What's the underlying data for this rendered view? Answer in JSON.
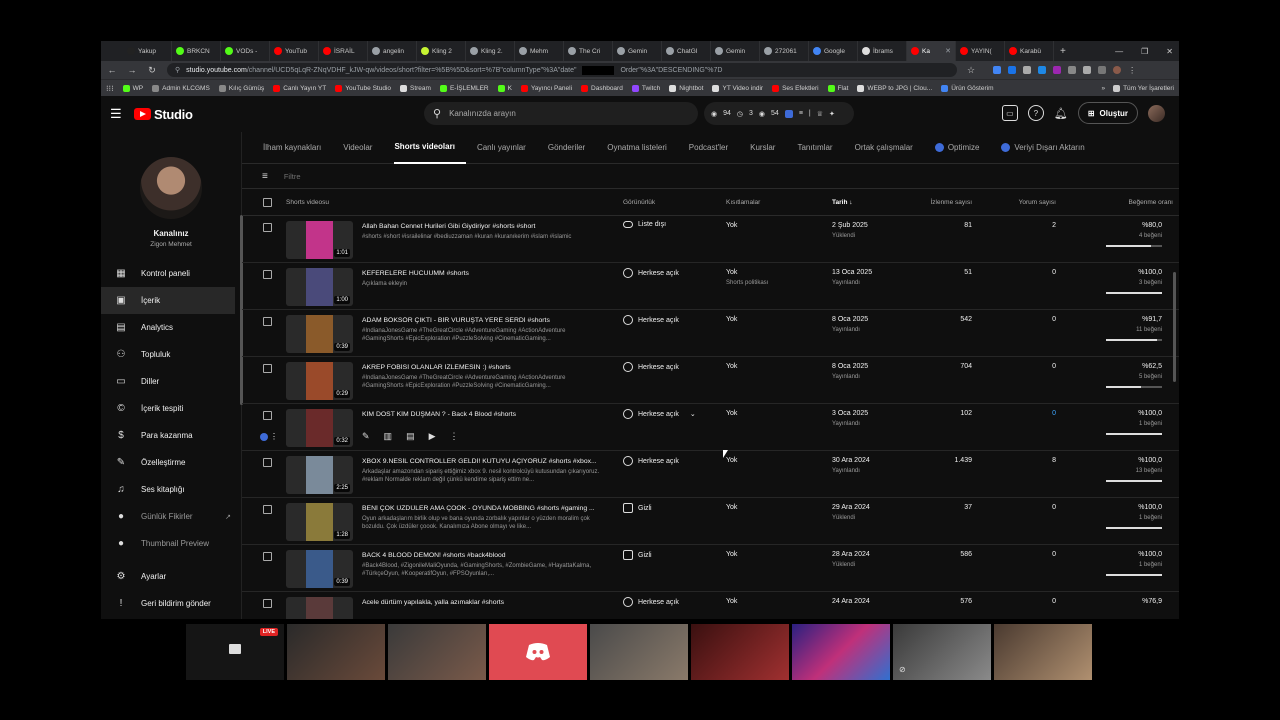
{
  "browser": {
    "tabs": [
      {
        "label": "Yakup",
        "color": "#222"
      },
      {
        "label": "BRKCN",
        "color": "#53fc18"
      },
      {
        "label": "VODs -",
        "color": "#53fc18"
      },
      {
        "label": "YouTub",
        "color": "#ff0000"
      },
      {
        "label": "İSRAİL",
        "color": "#ff0000"
      },
      {
        "label": "angelin",
        "color": "#9aa0a6"
      },
      {
        "label": "Kling 2",
        "color": "#c6f432"
      },
      {
        "label": "Kling 2.",
        "color": "#9aa0a6"
      },
      {
        "label": "Mehm",
        "color": "#9aa0a6"
      },
      {
        "label": "The Cri",
        "color": "#9aa0a6"
      },
      {
        "label": "Gemin",
        "color": "#9aa0a6"
      },
      {
        "label": "ChatGI",
        "color": "#9aa0a6"
      },
      {
        "label": "Gemin",
        "color": "#9aa0a6"
      },
      {
        "label": "272061",
        "color": "#9aa0a6"
      },
      {
        "label": "Google",
        "color": "#4285f4"
      },
      {
        "label": "İbrams",
        "color": "#ddd"
      },
      {
        "label": "Ka",
        "color": "#ff0000"
      },
      {
        "label": "YAYIN(",
        "color": "#ff0000"
      },
      {
        "label": "Karabü",
        "color": "#ff0000"
      }
    ],
    "active_tab": 16,
    "url_host": "studio.youtube.com",
    "url_path": "/channel/UCD5qLqR-ZNqVDHF_kJW-qw/videos/short?filter=%5B%5D&sort=%7B\"columnType\"%3A\"date\"",
    "url_tail": "Order\"%3A\"DESCENDING\"%7D",
    "bookmarks": [
      {
        "label": "WP",
        "color": "#53fc18"
      },
      {
        "label": "Admin KLCGMS",
        "color": "#888"
      },
      {
        "label": "Kılıç Gümüş",
        "color": "#888"
      },
      {
        "label": "Canlı Yayın YT",
        "color": "#ff0000"
      },
      {
        "label": "YouTube Studio",
        "color": "#ff0000"
      },
      {
        "label": "Stream",
        "color": "#ddd"
      },
      {
        "label": "E-İŞLEMLER",
        "color": "#53fc18"
      },
      {
        "label": "K",
        "color": "#53fc18"
      },
      {
        "label": "Yayıncı Paneli",
        "color": "#ff0000"
      },
      {
        "label": "Dashboard",
        "color": "#ff0000"
      },
      {
        "label": "Twitch",
        "color": "#9147ff"
      },
      {
        "label": "Nightbot",
        "color": "#ddd"
      },
      {
        "label": "YT Video indir",
        "color": "#ddd"
      },
      {
        "label": "Ses Efektleri",
        "color": "#ff0000"
      },
      {
        "label": "Flat",
        "color": "#53fc18"
      },
      {
        "label": "WEBP to JPG | Clou...",
        "color": "#ddd"
      },
      {
        "label": "Ürün Gösterim",
        "color": "#4285f4"
      }
    ],
    "bookmarks_more": "»",
    "all_bookmarks": "Tüm Yer İşaretleri"
  },
  "header": {
    "logo_text": "Studio",
    "search_placeholder": "Kanalınızda arayın",
    "stats": [
      "94",
      "3",
      "54"
    ],
    "create_label": "Oluştur"
  },
  "sidebar": {
    "channel_title": "Kanalınız",
    "channel_name": "Zigon Mehmet",
    "items": [
      {
        "label": "Kontrol paneli",
        "icon": "dashboard-icon",
        "glyph": "▦"
      },
      {
        "label": "İçerik",
        "icon": "content-icon",
        "glyph": "▣"
      },
      {
        "label": "Analytics",
        "icon": "analytics-icon",
        "glyph": "▤"
      },
      {
        "label": "Topluluk",
        "icon": "community-icon",
        "glyph": "⚇"
      },
      {
        "label": "Diller",
        "icon": "subtitles-icon",
        "glyph": "▭"
      },
      {
        "label": "İçerik tespiti",
        "icon": "copyright-icon",
        "glyph": "©"
      },
      {
        "label": "Para kazanma",
        "icon": "monetization-icon",
        "glyph": "$"
      },
      {
        "label": "Özelleştirme",
        "icon": "customization-icon",
        "glyph": "✎"
      },
      {
        "label": "Ses kitaplığı",
        "icon": "audio-library-icon",
        "glyph": "♫"
      },
      {
        "label": "Günlük Fikirler",
        "icon": "daily-ideas-icon",
        "glyph": "●"
      },
      {
        "label": "Thumbnail Preview",
        "icon": "thumbnail-preview-icon",
        "glyph": "●"
      },
      {
        "label": "Ayarlar",
        "icon": "settings-icon",
        "glyph": "⚙"
      },
      {
        "label": "Geri bildirim gönder",
        "icon": "feedback-icon",
        "glyph": "!"
      }
    ]
  },
  "content": {
    "tabs": [
      "İlham kaynakları",
      "Videolar",
      "Shorts videoları",
      "Canlı yayınlar",
      "Gönderiler",
      "Oynatma listeleri",
      "Podcast'ler",
      "Kurslar",
      "Tanıtımlar",
      "Ortak çalışmalar",
      "Optimize",
      "Veriyi Dışarı Aktarın"
    ],
    "active_tab": 2,
    "filter_placeholder": "Filtre",
    "columns": {
      "video": "Shorts videosu",
      "visibility": "Görünürlük",
      "restrictions": "Kısıtlamalar",
      "date": "Tarih",
      "views": "İzlenme sayısı",
      "comments": "Yorum sayısı",
      "likes": "Beğenme oranı"
    },
    "rows": [
      {
        "title": "Allah Bahan Cennet Hurileri Gibi Giydiriyor #shorts #short",
        "desc": "#shorts #short #israilelinar #bediuzzaman #kuran #kuranıkerim #islam #islamic",
        "duration": "1:01",
        "visibility": "Liste dışı",
        "vis_icon": "link-icon",
        "restriction": "Yok",
        "restriction_sub": "",
        "date": "2 Şub 2025",
        "status": "Yüklendi",
        "views": "81",
        "comments": "2",
        "likes_pct": "%80,0",
        "likes_sub": "4 beğeni",
        "like_ratio": 0.8,
        "thumb": "#c2348a"
      },
      {
        "title": "KEFERELERE HÜCUUMM #shorts",
        "desc": "Açıklama ekleyin",
        "duration": "1:00",
        "visibility": "Herkese açık",
        "vis_icon": "globe-icon",
        "restriction": "Yok",
        "restriction_sub": "Shorts politikası",
        "date": "13 Oca 2025",
        "status": "Yayınlandı",
        "views": "51",
        "comments": "0",
        "likes_pct": "%100,0",
        "likes_sub": "3 beğeni",
        "like_ratio": 1.0,
        "thumb": "#4a4a7a"
      },
      {
        "title": "ADAM BÖKSÖR ÇIKTI - BİR VURUŞTA YERE SERDİ #shorts",
        "desc": "#IndianaJonesGame #TheGreatCircle #AdventureGaming #ActionAdventure #GamingShorts #EpicExploration #PuzzleSolving #CinematicGaming...",
        "duration": "0:39",
        "visibility": "Herkese açık",
        "vis_icon": "globe-icon",
        "restriction": "Yok",
        "restriction_sub": "",
        "date": "8 Oca 2025",
        "status": "Yayınlandı",
        "views": "542",
        "comments": "0",
        "likes_pct": "%91,7",
        "likes_sub": "11 beğeni",
        "like_ratio": 0.917,
        "thumb": "#8a5a2a"
      },
      {
        "title": "AKREP FOBİSİ OLANLAR İZLEMESİN :) #shorts",
        "desc": "#IndianaJonesGame #TheGreatCircle #AdventureGaming #ActionAdventure #GamingShorts #EpicExploration #PuzzleSolving #CinematicGaming...",
        "duration": "0:29",
        "visibility": "Herkese açık",
        "vis_icon": "globe-icon",
        "restriction": "Yok",
        "restriction_sub": "",
        "date": "8 Oca 2025",
        "status": "Yayınlandı",
        "views": "704",
        "comments": "0",
        "likes_pct": "%62,5",
        "likes_sub": "5 beğeni",
        "like_ratio": 0.625,
        "thumb": "#9a4a2a"
      },
      {
        "title": "KİM DOST KİM DÜŞMAN ? - Back 4 Blood #shorts",
        "desc": "",
        "duration": "0:32",
        "visibility": "Herkese açık",
        "vis_icon": "globe-icon",
        "restriction": "Yok",
        "restriction_sub": "",
        "date": "3 Oca 2025",
        "status": "Yayınlandı",
        "views": "102",
        "comments": "0",
        "likes_pct": "%100,0",
        "likes_sub": "1 beğeni",
        "like_ratio": 1.0,
        "thumb": "#6a2a2a",
        "hover": true
      },
      {
        "title": "XBOX 9.NESİL CONTROLLER GELDİ! KUTUYU AÇIYORUZ #shorts #xbox...",
        "desc": "Arkadaşlar amazondan sipariş ettiğimiz xbox 9. nesil kontrolcüyü kutusundan çıkarıyoruz. #reklam Normalde reklam değil çünkü kendime sipariş ettim ne...",
        "duration": "2:25",
        "visibility": "Herkese açık",
        "vis_icon": "globe-icon",
        "restriction": "Yok",
        "restriction_sub": "",
        "date": "30 Ara 2024",
        "status": "Yayınlandı",
        "views": "1.439",
        "comments": "8",
        "likes_pct": "%100,0",
        "likes_sub": "13 beğeni",
        "like_ratio": 1.0,
        "thumb": "#7a8a9a"
      },
      {
        "title": "BENİ ÇOK ÜZDÜLER AMA ÇOOK - OYUNDA MOBBİNG #shorts #gaming ...",
        "desc": "Oyun arkadaşlarım birlik olup ve bana oyunda zorbalık yapınlar o yüzden moralim çok bozuldu. Çok üzdüler çoook. Kanalımıza Abone olmayı ve like...",
        "duration": "1:28",
        "visibility": "Gizli",
        "vis_icon": "lock-icon",
        "restriction": "Yok",
        "restriction_sub": "",
        "date": "29 Ara 2024",
        "status": "Yüklendi",
        "views": "37",
        "comments": "0",
        "likes_pct": "%100,0",
        "likes_sub": "1 beğeni",
        "like_ratio": 1.0,
        "thumb": "#8a7a3a"
      },
      {
        "title": "BACK 4 BLOOD DEMON! #shorts #back4blood",
        "desc": "#Back4Blood, #ZigonileMaliOyunda, #GamingShorts, #ZombieGame, #HayattaKalma, #TürkçeOyun, #KooperatifOyun, #FPSOyunları,...",
        "duration": "0:39",
        "visibility": "Gizli",
        "vis_icon": "lock-icon",
        "restriction": "Yok",
        "restriction_sub": "",
        "date": "28 Ara 2024",
        "status": "Yüklendi",
        "views": "586",
        "comments": "0",
        "likes_pct": "%100,0",
        "likes_sub": "1 beğeni",
        "like_ratio": 1.0,
        "thumb": "#3a5a8a"
      },
      {
        "title": "Acele dürtüm yapılakla, yalla azımaklar #shorts",
        "desc": "",
        "duration": "",
        "visibility": "Herkese açık",
        "vis_icon": "globe-icon",
        "restriction": "Yok",
        "restriction_sub": "",
        "date": "24 Ara 2024",
        "status": "",
        "views": "576",
        "comments": "0",
        "likes_pct": "%76,9",
        "likes_sub": "",
        "like_ratio": 0.769,
        "thumb": "#5a3a3a"
      }
    ]
  },
  "webcam_strip": {
    "live_badge": "LIVE"
  },
  "colors": {
    "accent": "#3ea6ff",
    "brand": "#ff0000",
    "bg": "#0f0f0f"
  }
}
